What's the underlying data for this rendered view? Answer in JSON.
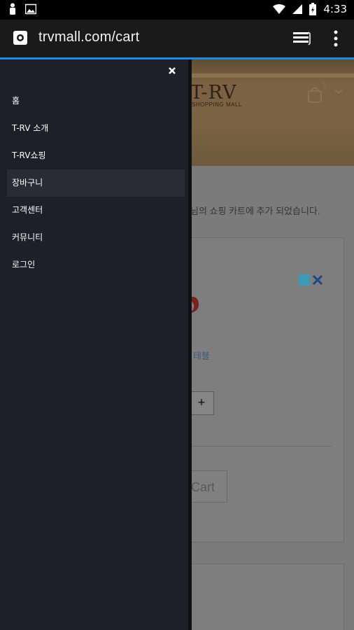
{
  "status_bar": {
    "time": "4:33"
  },
  "browser": {
    "url": "trvmall.com/cart"
  },
  "page": {
    "brand": "T-RV",
    "brand_sub": "SHOPPING MALL",
    "cart_count": "1",
    "notice_fragment": "님의 쇼핑 카트에 추가 되었습니다.",
    "link_fragment": "테블",
    "plus_label": "+",
    "cart_button_fragment": "Cart"
  },
  "drawer": {
    "items": [
      {
        "label": "홈"
      },
      {
        "label": "T-RV 소개"
      },
      {
        "label": "T-RV쇼핑"
      },
      {
        "label": "장바구니",
        "active": true
      },
      {
        "label": "고객센터"
      },
      {
        "label": "커뮤니티"
      },
      {
        "label": "로그인"
      }
    ]
  },
  "colors": {
    "accent": "#1e88e5",
    "drawer_bg": "#1e2027"
  }
}
